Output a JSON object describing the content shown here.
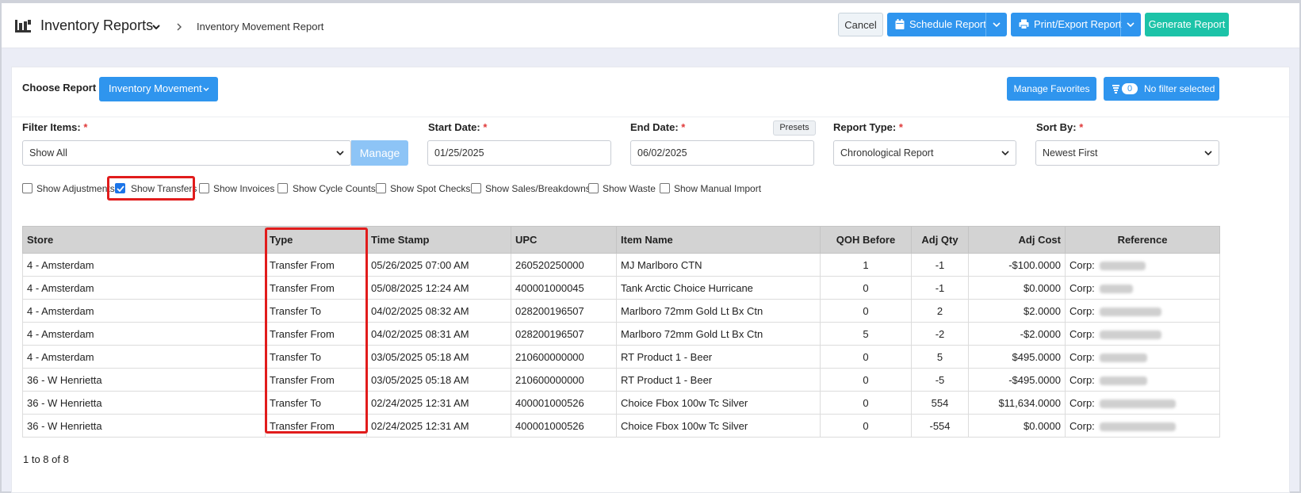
{
  "header": {
    "title": "Inventory Reports",
    "breadcrumb": "Inventory Movement Report",
    "cancel": "Cancel",
    "schedule": "Schedule Report",
    "print_export": "Print/Export Report",
    "generate": "Generate Report"
  },
  "report": {
    "choose_label": "Choose Report",
    "selected": "Inventory Movement",
    "manage_favorites": "Manage Favorites",
    "filter_count": "0",
    "filter_text": "No filter selected"
  },
  "filters": {
    "filter_items_label": "Filter Items:",
    "filter_items_value": "Show All",
    "manage": "Manage",
    "start_date_label": "Start Date:",
    "start_date": "01/25/2025",
    "end_date_label": "End Date:",
    "end_date": "06/02/2025",
    "presets": "Presets",
    "report_type_label": "Report Type:",
    "report_type": "Chronological Report",
    "sort_by_label": "Sort By:",
    "sort_by": "Newest First",
    "required_mark": "*"
  },
  "checkboxes": [
    {
      "label": "Show Adjustments",
      "checked": false
    },
    {
      "label": "Show Transfers",
      "checked": true
    },
    {
      "label": "Show Invoices",
      "checked": false
    },
    {
      "label": "Show Cycle Counts",
      "checked": false
    },
    {
      "label": "Show Spot Checks",
      "checked": false
    },
    {
      "label": "Show Sales/Breakdowns",
      "checked": false
    },
    {
      "label": "Show Waste",
      "checked": false
    },
    {
      "label": "Show Manual Import",
      "checked": false
    }
  ],
  "table": {
    "columns": [
      "Store",
      "Type",
      "Time Stamp",
      "UPC",
      "Item Name",
      "QOH Before",
      "Adj Qty",
      "Adj Cost",
      "Reference"
    ],
    "rows": [
      [
        "4 - Amsterdam",
        "Transfer From",
        "05/26/2025 07:00 AM",
        "260520250000",
        "MJ Marlboro CTN",
        "1",
        "-1",
        "-$100.0000",
        "Corp:"
      ],
      [
        "4 - Amsterdam",
        "Transfer From",
        "05/08/2025 12:24 AM",
        "400001000045",
        "Tank Arctic Choice Hurricane",
        "0",
        "-1",
        "$0.0000",
        "Corp:"
      ],
      [
        "4 - Amsterdam",
        "Transfer To",
        "04/02/2025 08:32 AM",
        "028200196507",
        "Marlboro 72mm Gold Lt Bx Ctn",
        "0",
        "2",
        "$2.0000",
        "Corp:"
      ],
      [
        "4 - Amsterdam",
        "Transfer From",
        "04/02/2025 08:31 AM",
        "028200196507",
        "Marlboro 72mm Gold Lt Bx Ctn",
        "5",
        "-2",
        "-$2.0000",
        "Corp:"
      ],
      [
        "4 - Amsterdam",
        "Transfer To",
        "03/05/2025 05:18 AM",
        "210600000000",
        "RT Product 1 - Beer",
        "0",
        "5",
        "$495.0000",
        "Corp:"
      ],
      [
        "36 - W Henrietta",
        "Transfer From",
        "03/05/2025 05:18 AM",
        "210600000000",
        "RT Product 1 - Beer",
        "0",
        "-5",
        "-$495.0000",
        "Corp:"
      ],
      [
        "36 - W Henrietta",
        "Transfer To",
        "02/24/2025 12:31 AM",
        "400001000526",
        "Choice Fbox 100w Tc Silver",
        "0",
        "554",
        "$11,634.0000",
        "Corp:"
      ],
      [
        "36 - W Henrietta",
        "Transfer From",
        "02/24/2025 12:31 AM",
        "400001000526",
        "Choice Fbox 100w Tc Silver",
        "0",
        "-554",
        "$0.0000",
        "Corp:"
      ]
    ]
  },
  "pager": "1 to 8 of 8",
  "colors": {
    "accent": "#2f95ee",
    "generate": "#1cc3a8",
    "highlight": "#e11c1c",
    "header_row": "#d3d3d3"
  }
}
